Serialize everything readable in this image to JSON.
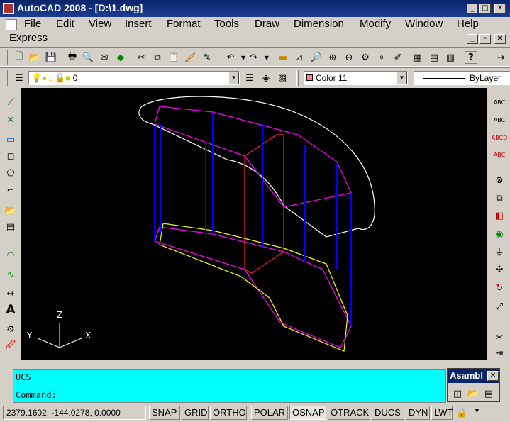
{
  "window": {
    "title": "AutoCAD 2008 - [D:\\1.dwg]",
    "min": "_",
    "max": "□",
    "close": "✕"
  },
  "menus": [
    "File",
    "Edit",
    "View",
    "Insert",
    "Format",
    "Tools",
    "Draw",
    "Dimension",
    "Modify",
    "Window",
    "Help",
    "Express"
  ],
  "layer": {
    "name": "0"
  },
  "color": {
    "name": "Color 11",
    "swatch": "#ff8080"
  },
  "linetype": {
    "name": "ByLayer"
  },
  "command": {
    "line1": "UCS",
    "line2": "Command:"
  },
  "status": {
    "coords": "2379.1602, -144.0278, 0.0000",
    "buttons": [
      "SNAP",
      "GRID",
      "ORTHO",
      "POLAR",
      "OSNAP",
      "OTRACK",
      "DUCS",
      "DYN",
      "LWT"
    ],
    "active": "OSNAP"
  },
  "palette": {
    "title": "Asambl"
  },
  "ucs": {
    "x": "X",
    "y": "Y",
    "z": "Z"
  },
  "colors": {
    "magenta": "#ff00ff",
    "blue": "#0000ff",
    "red": "#ff2020",
    "white": "#ffffff",
    "yellow": "#ffff00"
  }
}
